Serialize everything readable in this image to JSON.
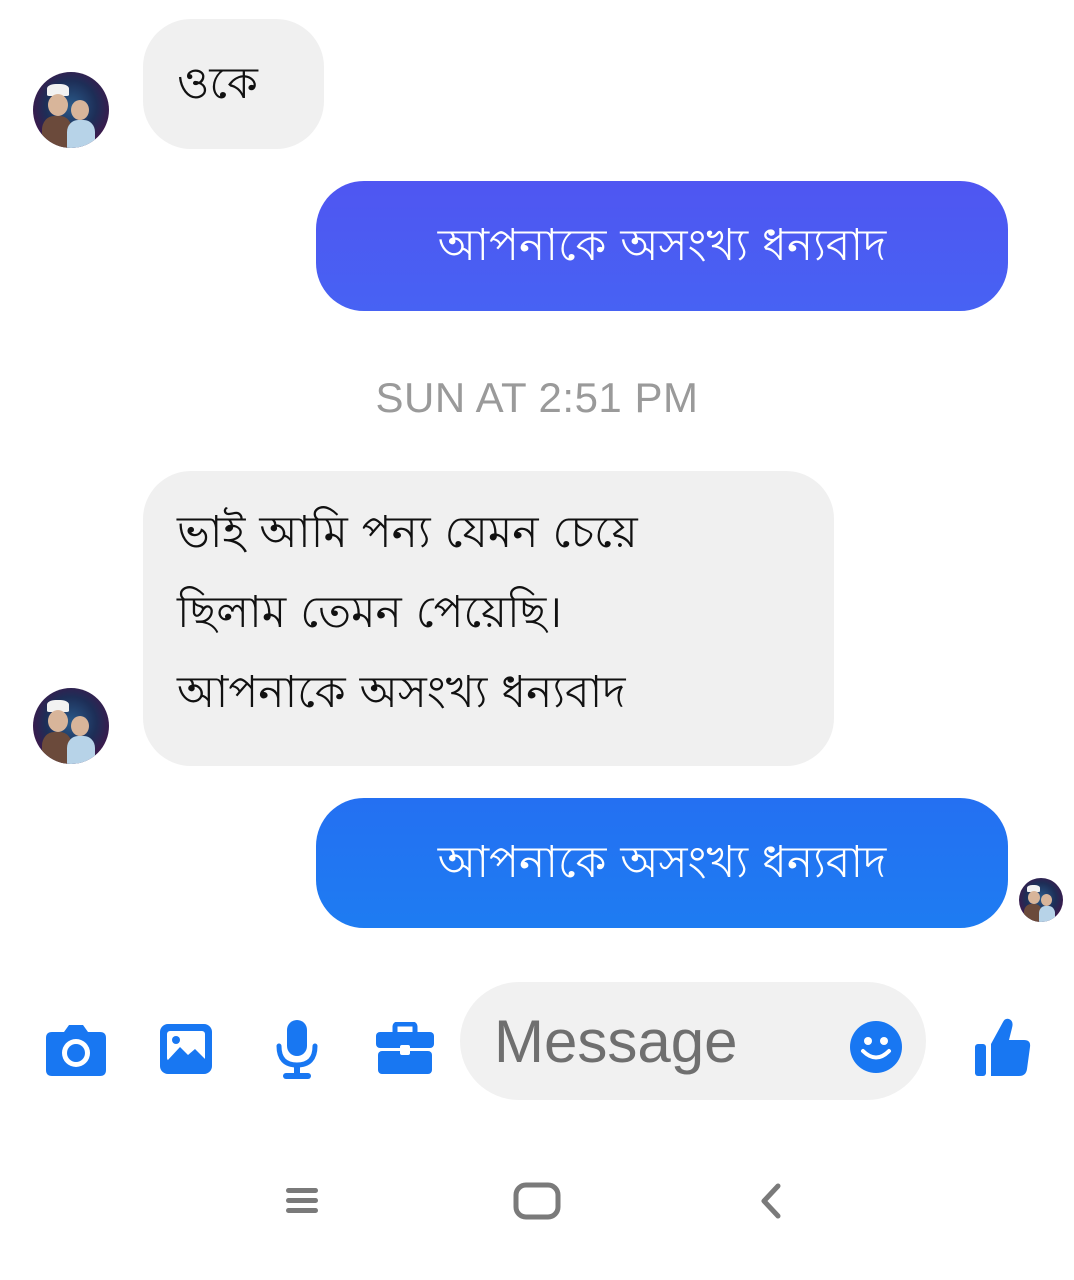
{
  "colors": {
    "outgoing_gradient_top": "#4a5cf2",
    "outgoing_gradient_bottom": "#1f7df2",
    "accent": "#1877f2",
    "incoming_bubble": "#f0f0f0",
    "timestamp": "#9a9a9a"
  },
  "conversation": {
    "messages": [
      {
        "direction": "incoming",
        "text": "ওকে"
      },
      {
        "direction": "outgoing",
        "text": "আপনাকে অসংখ্য ধন্যবাদ"
      },
      {
        "direction": "incoming",
        "lines": [
          "ভাই আমি পন্য যেমন চেয়ে",
          "ছিলাম তেমন পেয়েছি।",
          "আপনাকে অসংখ্য ধন্যবাদ"
        ]
      },
      {
        "direction": "outgoing",
        "text": "আপনাকে অসংখ্য ধন্যবাদ"
      }
    ],
    "timestamp": "SUN AT 2:51 PM"
  },
  "composer": {
    "placeholder": "Message",
    "icons": [
      "camera-icon",
      "gallery-icon",
      "microphone-icon",
      "briefcase-icon",
      "emoji-icon",
      "thumbs-up-icon"
    ]
  },
  "system_nav": {
    "icons": [
      "recent-apps-icon",
      "home-icon",
      "back-icon"
    ]
  }
}
